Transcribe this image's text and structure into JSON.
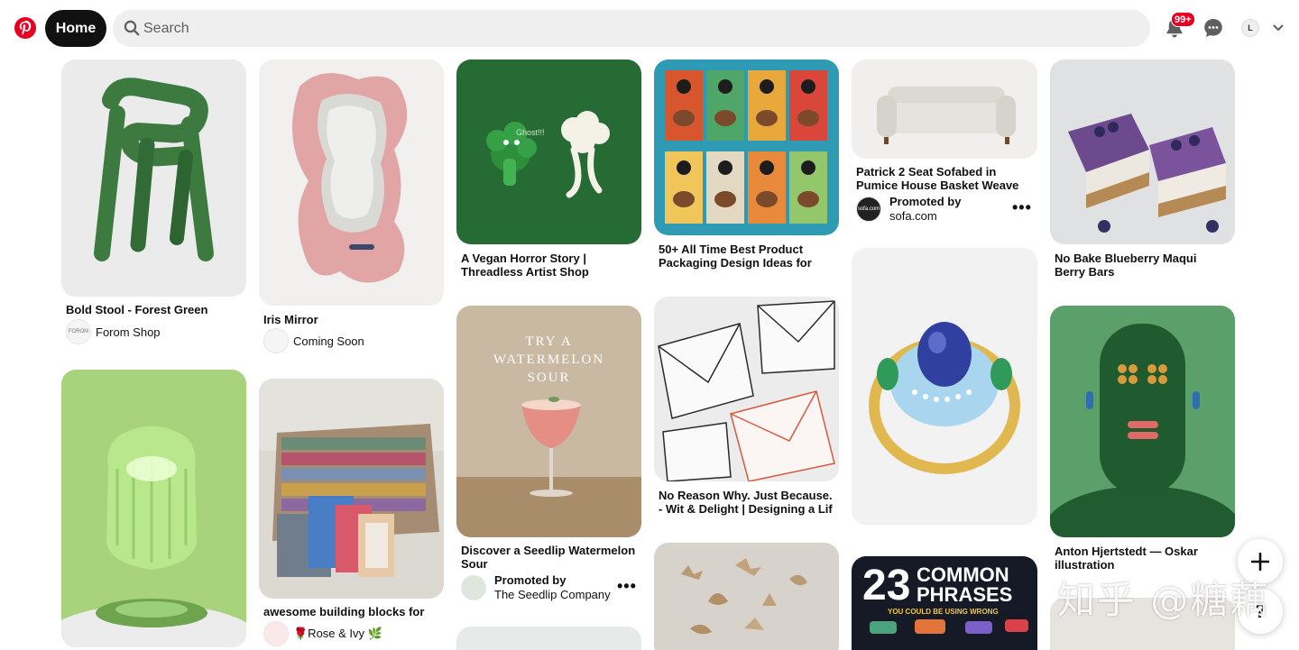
{
  "header": {
    "home_label": "Home",
    "search_placeholder": "Search",
    "notification_count": "99+",
    "avatar_initial": "L",
    "icons": [
      "pinterest-logo",
      "search-icon",
      "bell-icon",
      "chat-icon",
      "chevron-down-icon"
    ]
  },
  "pins": {
    "bold_stool": {
      "title": "Bold Stool - Forest Green",
      "source": "Forom Shop",
      "avatar_text": "FOROM"
    },
    "iris_mirror": {
      "title": "Iris Mirror",
      "source": "Coming Soon"
    },
    "vegan_horror": {
      "title": "A Vegan Horror Story | Threadless Artist Shop",
      "image_text": "Ghost!!!"
    },
    "packaging": {
      "title": "50+ All Time Best Product Packaging Design Ideas for"
    },
    "sofa": {
      "title": "Patrick 2 Seat Sofabed in Pumice House Basket Weave",
      "promoted_label": "Promoted by",
      "promoter": "sofa.com",
      "avatar_text": "sofa.com"
    },
    "blueberry_bars": {
      "title": "No Bake Blueberry Maqui Berry Bars"
    },
    "watermelon_sour": {
      "title": "Discover a Seedlip Watermelon Sour",
      "image_text": "TRY A WATERMELON SOUR",
      "promoted_label": "Promoted by",
      "promoter": "The Seedlip Company"
    },
    "no_reason": {
      "title": "No Reason Why. Just Because. - Wit & Delight | Designing a Lif"
    },
    "anton": {
      "title": "Anton Hjertstedt — Oskar illustration"
    },
    "building_blocks": {
      "title": "awesome building blocks for",
      "source": "🌹Rose & Ivy 🌿"
    },
    "common_phrases": {
      "image_text_number": "23",
      "image_text_word": "COMMON PHRASES",
      "image_text_sub": "YOU COULD BE USING WRONG"
    }
  },
  "watermark": "知乎 @糖藕",
  "colors": {
    "brand": "#e60023",
    "text": "#111111",
    "search_bg": "#efefef"
  }
}
